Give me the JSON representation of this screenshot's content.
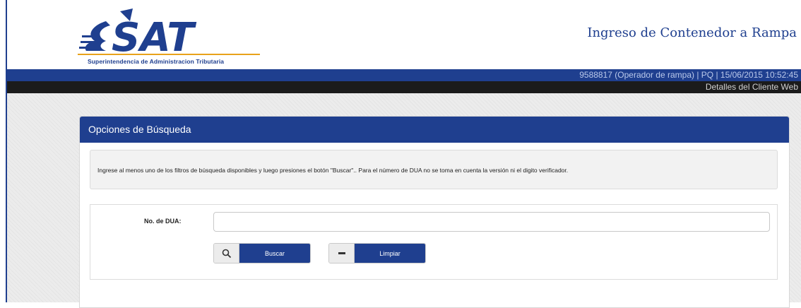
{
  "branding": {
    "logo_text": "SAT",
    "logo_subtitle": "Superintendencia de Administracion Tributaria"
  },
  "header": {
    "title": "Ingreso de Contenedor a Rampa"
  },
  "user_bar": {
    "text": "9588817 (Operador de rampa) | PQ | 15/06/2015 10:52:45"
  },
  "client_bar": {
    "text": "Detalles del Cliente Web"
  },
  "panel": {
    "title": "Opciones de Búsqueda",
    "notice": "Ingrese al menos uno de los filtros de búsqueda disponibles y luego presiones el botón \"Buscar\".. Para el número de DUA no se toma en cuenta la versión ni el digito verificador.",
    "form": {
      "dua_label": "No. de DUA:",
      "dua_value": ""
    },
    "buttons": {
      "search_label": "Buscar",
      "search_icon": "search-icon",
      "clear_label": "Limpiar",
      "clear_icon": "minus-icon"
    }
  },
  "colors": {
    "brand_blue": "#1f3f8f",
    "dark_bar": "#1b1b1b"
  }
}
